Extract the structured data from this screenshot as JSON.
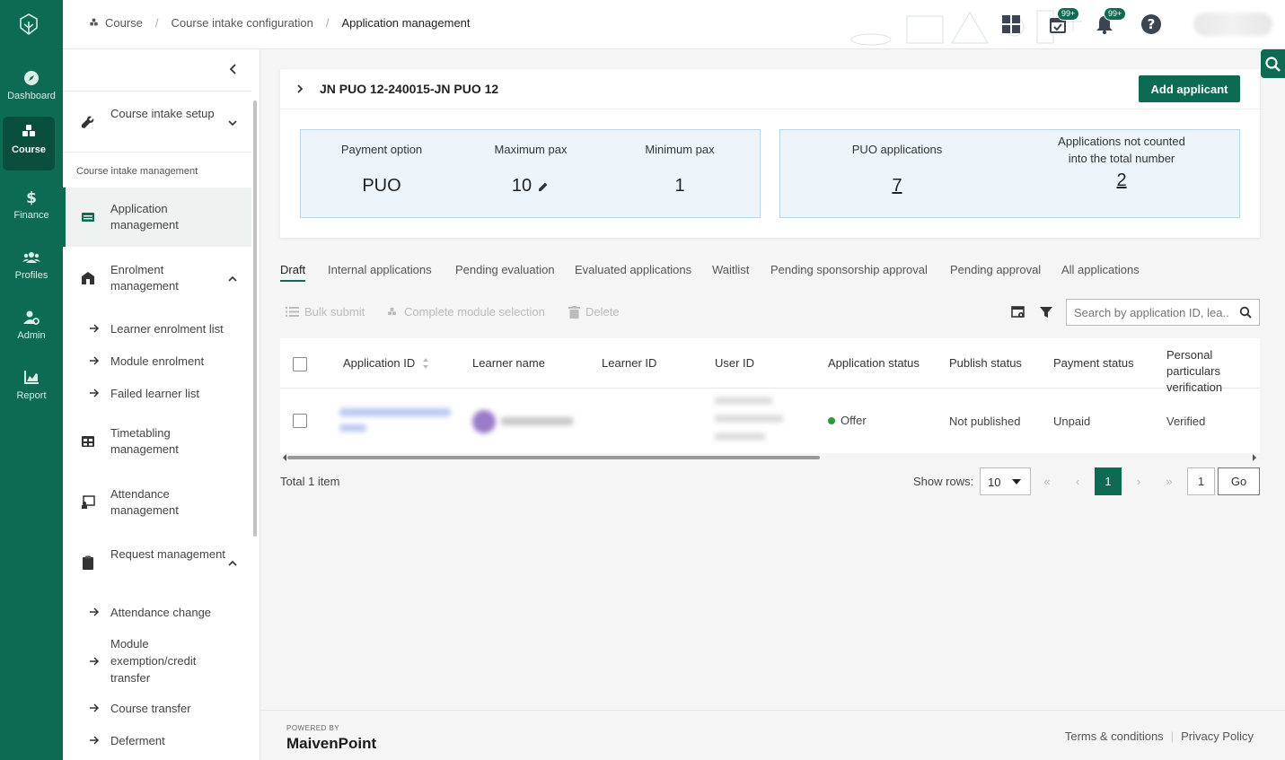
{
  "colors": {
    "brand": "#0e6b53",
    "brand_dark": "#0a4f3d",
    "offer_dot": "#2e9b3a",
    "stat_bg": "#eef5fa"
  },
  "rail": {
    "items": [
      {
        "label": "Dashboard",
        "icon": "compass-icon"
      },
      {
        "label": "Course",
        "icon": "cubes-icon"
      },
      {
        "label": "Finance",
        "icon": "dollar-icon"
      },
      {
        "label": "Profiles",
        "icon": "users-icon"
      },
      {
        "label": "Admin",
        "icon": "user-gear-icon"
      },
      {
        "label": "Report",
        "icon": "chart-icon"
      }
    ]
  },
  "breadcrumb": {
    "items": [
      "Course",
      "Course intake configuration",
      "Application management"
    ]
  },
  "topbar": {
    "task_badge": "99+",
    "notif_badge": "99+"
  },
  "sidebar": {
    "setup_label": "Course intake setup",
    "section_label": "Course intake management",
    "items": [
      {
        "label": "Application management"
      },
      {
        "label": "Enrolment management"
      },
      {
        "label": "Timetabling management"
      },
      {
        "label": "Attendance management"
      },
      {
        "label": "Request management"
      }
    ],
    "enrolment_sub": [
      "Learner enrolment list",
      "Module enrolment",
      "Failed learner list"
    ],
    "request_sub": [
      "Attendance change",
      "Module exemption/credit transfer",
      "Course transfer",
      "Deferment"
    ]
  },
  "card": {
    "title": "JN PUO 12-240015-JN PUO 12",
    "add_button": "Add applicant",
    "stats_left": [
      {
        "label": "Payment option",
        "value": "PUO"
      },
      {
        "label": "Maximum pax",
        "value": "10"
      },
      {
        "label": "Minimum pax",
        "value": "1"
      }
    ],
    "stats_right": [
      {
        "label": "PUO applications",
        "value": "7"
      },
      {
        "label": "Applications not counted into the total number",
        "value": "2"
      }
    ]
  },
  "tabs": [
    "Draft",
    "Internal applications",
    "Pending evaluation",
    "Evaluated applications",
    "Waitlist",
    "Pending sponsorship approval",
    "Pending approval",
    "All applications"
  ],
  "toolbar": {
    "bulk_submit": "Bulk submit",
    "complete_module": "Complete module selection",
    "delete": "Delete",
    "search_placeholder": "Search by application ID, lea..."
  },
  "table": {
    "headers": [
      "Application ID",
      "Learner name",
      "Learner ID",
      "User ID",
      "Application status",
      "Publish status",
      "Payment status",
      "Personal particulars verification"
    ],
    "rows": [
      {
        "application_status": "Offer",
        "publish_status": "Not published",
        "payment_status": "Unpaid",
        "verification": "Verified"
      }
    ]
  },
  "pagination": {
    "total": "Total 1 item",
    "show_rows_label": "Show rows:",
    "rows_value": "10",
    "current_page": "1",
    "jump_value": "1",
    "go_label": "Go"
  },
  "footer": {
    "powered_by": "POWERED BY",
    "brand": "MaivenPoint",
    "links": [
      "Terms & conditions",
      "Privacy Policy"
    ]
  }
}
